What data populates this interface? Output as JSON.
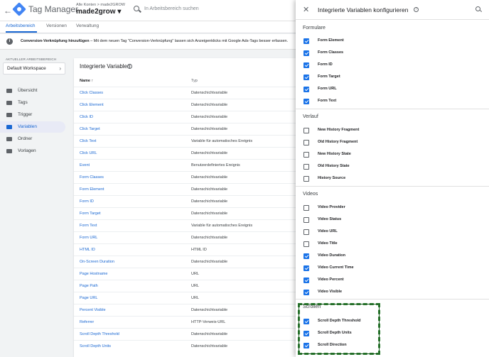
{
  "header": {
    "app_title": "Tag Manager",
    "breadcrumb": "Alle Konten > made2GROW",
    "account": "made2grow ▾",
    "search_placeholder": "In Arbeitsbereich suchen"
  },
  "tabs": [
    "Arbeitsbereich",
    "Versionen",
    "Verwaltung"
  ],
  "banner": {
    "bold": "Conversion-Verknüpfung hinzufügen",
    "text": " – Mit dem neuen Tag \"Conversion-Verknüpfung\" lassen sich Anzeigenklicks mit Google Ads-Tags besser erfassen."
  },
  "sidebar": {
    "workspace_label": "AKTUELLER ARBEITSBEREICH",
    "workspace_name": "Default Workspace",
    "items": [
      {
        "label": "Übersicht",
        "icon": "overview-icon"
      },
      {
        "label": "Tags",
        "icon": "tag-icon"
      },
      {
        "label": "Trigger",
        "icon": "trigger-icon"
      },
      {
        "label": "Variablen",
        "icon": "variables-icon"
      },
      {
        "label": "Ordner",
        "icon": "folder-icon"
      },
      {
        "label": "Vorlagen",
        "icon": "template-icon"
      }
    ]
  },
  "main": {
    "title": "Integrierte Variablen",
    "col_name": "Name ↑",
    "col_type": "Typ",
    "rows": [
      [
        "Click Classes",
        "Datenschichtvariable"
      ],
      [
        "Click Element",
        "Datenschichtvariable"
      ],
      [
        "Click ID",
        "Datenschichtvariable"
      ],
      [
        "Click Target",
        "Datenschichtvariable"
      ],
      [
        "Click Text",
        "Variable für automatisches Ereignis"
      ],
      [
        "Click URL",
        "Datenschichtvariable"
      ],
      [
        "Event",
        "Benutzerdefiniertes Ereignis"
      ],
      [
        "Form Classes",
        "Datenschichtvariable"
      ],
      [
        "Form Element",
        "Datenschichtvariable"
      ],
      [
        "Form ID",
        "Datenschichtvariable"
      ],
      [
        "Form Target",
        "Datenschichtvariable"
      ],
      [
        "Form Text",
        "Variable für automatisches Ereignis"
      ],
      [
        "Form URL",
        "Datenschichtvariable"
      ],
      [
        "HTML ID",
        "HTML ID"
      ],
      [
        "On-Screen Duration",
        "Datenschichtvariable"
      ],
      [
        "Page Hostname",
        "URL"
      ],
      [
        "Page Path",
        "URL"
      ],
      [
        "Page URL",
        "URL"
      ],
      [
        "Percent Visible",
        "Datenschichtvariable"
      ],
      [
        "Referrer",
        "HTTP-Verweis-URL"
      ],
      [
        "Scroll Depth Threshold",
        "Datenschichtvariable"
      ],
      [
        "Scroll Depth Units",
        "Datenschichtvariable"
      ]
    ]
  },
  "panel": {
    "title": "Integrierte Variablen konfigurieren",
    "sections": [
      {
        "title": "Formulare",
        "items": [
          {
            "label": "Form Element",
            "checked": true
          },
          {
            "label": "Form Classes",
            "checked": true
          },
          {
            "label": "Form ID",
            "checked": true
          },
          {
            "label": "Form Target",
            "checked": true
          },
          {
            "label": "Form URL",
            "checked": true
          },
          {
            "label": "Form Text",
            "checked": true
          }
        ]
      },
      {
        "title": "Verlauf",
        "items": [
          {
            "label": "New History Fragment",
            "checked": false
          },
          {
            "label": "Old History Fragment",
            "checked": false
          },
          {
            "label": "New History State",
            "checked": false
          },
          {
            "label": "Old History State",
            "checked": false
          },
          {
            "label": "History Source",
            "checked": false
          }
        ]
      },
      {
        "title": "Videos",
        "items": [
          {
            "label": "Video Provider",
            "checked": false
          },
          {
            "label": "Video Status",
            "checked": false
          },
          {
            "label": "Video URL",
            "checked": false
          },
          {
            "label": "Video Title",
            "checked": false
          },
          {
            "label": "Video Duration",
            "checked": true
          },
          {
            "label": "Video Current Time",
            "checked": true
          },
          {
            "label": "Video Percent",
            "checked": true
          },
          {
            "label": "Video Visible",
            "checked": true
          }
        ]
      },
      {
        "title": "Scrollen",
        "items": [
          {
            "label": "Scroll Depth Threshold",
            "checked": true
          },
          {
            "label": "Scroll Depth Units",
            "checked": true
          },
          {
            "label": "Scroll Direction",
            "checked": true
          }
        ]
      }
    ]
  },
  "colors": {
    "accent": "#1a73e8",
    "highlight": "#2e7d32"
  }
}
